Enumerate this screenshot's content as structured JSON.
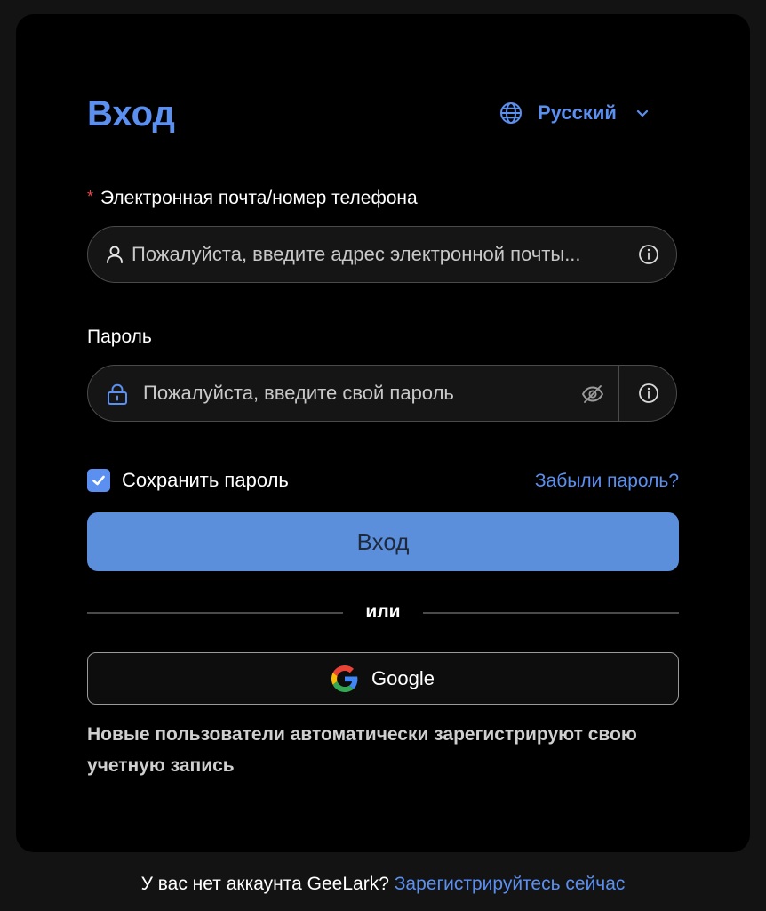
{
  "login": {
    "title": "Вход",
    "language": {
      "selected": "Русский",
      "icon": "globe-icon",
      "dropdown_icon": "chevron-down-icon"
    },
    "email": {
      "label": "Электронная почта/номер телефона",
      "required_mark": "*",
      "placeholder": "Пожалуйста, введите адрес электронной почты...",
      "value": "",
      "icon": "user-icon",
      "info_icon": "info-icon"
    },
    "password": {
      "label": "Пароль",
      "placeholder": "Пожалуйста, введите свой пароль",
      "value": "",
      "icon": "lock-icon",
      "visibility_icon": "eye-off-icon",
      "info_icon": "info-icon"
    },
    "remember": {
      "label": "Сохранить пароль",
      "checked": true
    },
    "forgot_label": "Забыли пароль?",
    "submit_label": "Вход",
    "divider_label": "или",
    "google_label": "Google",
    "notice": "Новые пользователи автоматически зарегистрируют свою учетную запись"
  },
  "footer": {
    "text": "У вас нет аккаунта GeeLark?",
    "link": "Зарегистрируйтесь сейчас"
  },
  "colors": {
    "accent": "#5b8ff0",
    "button": "#5b8fdc",
    "card_bg": "#000000",
    "page_bg": "#131313",
    "required": "#e5484d"
  }
}
